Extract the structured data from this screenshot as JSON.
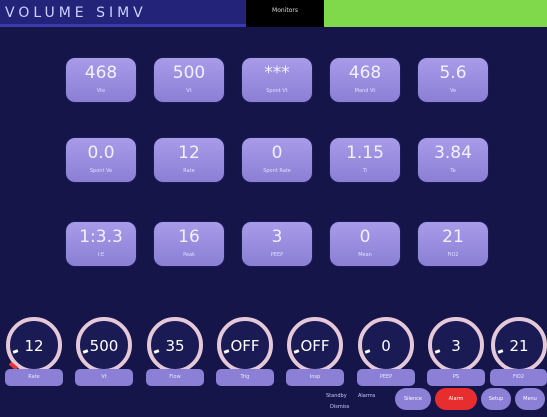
{
  "header": {
    "mode_title": "VOLUME SIMV",
    "monitors_tab": "Monitors"
  },
  "tiles": [
    {
      "value": "468",
      "label": "Vte"
    },
    {
      "value": "500",
      "label": "Vt"
    },
    {
      "value": "***",
      "label": "Spont Vt"
    },
    {
      "value": "468",
      "label": "Mand Vt"
    },
    {
      "value": "5.6",
      "label": "Ve"
    },
    {
      "value": "0.0",
      "label": "Spont Ve"
    },
    {
      "value": "12",
      "label": "Rate"
    },
    {
      "value": "0",
      "label": "Spont Rate"
    },
    {
      "value": "1.15",
      "label": "Ti"
    },
    {
      "value": "3.84",
      "label": "Te"
    },
    {
      "value": "1:3.3",
      "label": "I:E"
    },
    {
      "value": "16",
      "label": "Peak"
    },
    {
      "value": "3",
      "label": "PEEP"
    },
    {
      "value": "0",
      "label": "Mean"
    },
    {
      "value": "21",
      "label": "FiO2"
    }
  ],
  "knobs": [
    {
      "value": "12",
      "label": "Rate"
    },
    {
      "value": "500",
      "label": "Vt"
    },
    {
      "value": "35",
      "label": "Flow"
    },
    {
      "value": "OFF",
      "label": "Trig"
    },
    {
      "value": "OFF",
      "label": "Insp"
    },
    {
      "value": "0",
      "label": "PEEP"
    },
    {
      "value": "3",
      "label": "PS"
    },
    {
      "value": "21",
      "label": "FiO2"
    }
  ],
  "status": {
    "line1": "Standby",
    "line2": "Alarms",
    "line3": "Dismiss"
  },
  "buttons": {
    "btn1": "Silence",
    "btn2": "Alarm",
    "btn3": "Setup",
    "btn4": "Menu"
  },
  "colors": {
    "background": "#15154a",
    "tile": "#8b7fd6",
    "accent_green": "#7fd94a",
    "alert_red": "#e72d2d"
  }
}
